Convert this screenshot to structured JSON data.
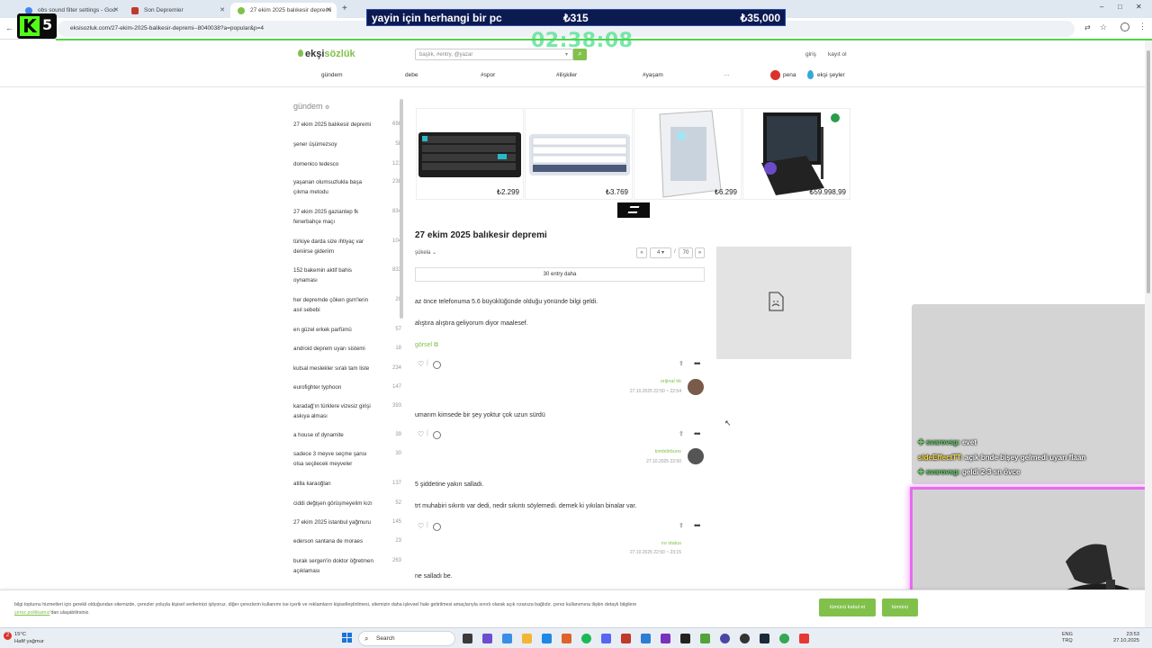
{
  "browser": {
    "tabs": [
      {
        "label": "obs sound filter settings - Goo",
        "active": false
      },
      {
        "label": "Son Depremler",
        "active": false
      },
      {
        "label": "27 ekim 2025 balıkesir depremi",
        "active": true
      }
    ],
    "new_tab": "+",
    "url": "eksisozluk.com/27-ekim-2025-balikesir-depremi--8040038?a=popular&p=4",
    "window_controls": [
      "–",
      "□",
      "✕"
    ]
  },
  "overlay": {
    "badge_number": "5",
    "goal_text": "yayin için herhangi bir pc",
    "goal_current": "₺315",
    "goal_target": "₺35,000",
    "timer": "02:38:08"
  },
  "site": {
    "logo_a": "ekşi",
    "logo_b": "sözlük",
    "search_placeholder": "başlık, #entry, @yazar",
    "login": "giriş",
    "register": "kayıt ol",
    "nav": [
      "gündem",
      "debe",
      "#spor",
      "#ilişkiler",
      "#yaşam",
      "···"
    ],
    "pena": "pena",
    "eksi_seyler": "ekşi şeyler"
  },
  "sidebar": {
    "title": "gündem",
    "items": [
      {
        "label": "27 ekim 2025 balıkesir depremi",
        "count": "698"
      },
      {
        "label": "şener üşümezsoy",
        "count": "58"
      },
      {
        "label": "domenico tedesco",
        "count": "121"
      },
      {
        "label": "yaşanan olumsuzlukla başa çıkma metodu",
        "count": "238"
      },
      {
        "label": "27 ekim 2025 gaziantep fk fenerbahçe maçı",
        "count": "834"
      },
      {
        "label": "türkiye darda size ihtiyaç var deniirse gideriim",
        "count": "104"
      },
      {
        "label": "152 bakemin aktif bahis oynaması",
        "count": "833"
      },
      {
        "label": "her depremde çöken gsm'lerin asıl sebebi",
        "count": "20"
      },
      {
        "label": "en güzel erkek parfümü",
        "count": "57"
      },
      {
        "label": "android deprem uyarı sistemi",
        "count": "18"
      },
      {
        "label": "kutsal meslekler sıralı tam liste",
        "count": "234"
      },
      {
        "label": "eurofighter typhoon",
        "count": "147"
      },
      {
        "label": "karadağ'ın türklere vizesiz girişi askıya alması",
        "count": "393"
      },
      {
        "label": "a house of dynamite",
        "count": "39"
      },
      {
        "label": "sadece 3 meyve seçme şansı olsa seçilecek meyveler",
        "count": "30"
      },
      {
        "label": "atilla karaoğlan",
        "count": "137"
      },
      {
        "label": "ciddi değişen görüşmeyelim kızı",
        "count": "52"
      },
      {
        "label": "27 ekim 2025 istanbul yağmuru",
        "count": "145"
      },
      {
        "label": "ederson santana de moraes",
        "count": "23"
      },
      {
        "label": "burak sergen'in doktor öğretmen açıklaması",
        "count": "263"
      }
    ]
  },
  "ads": [
    {
      "price": "₺2.299",
      "icon": "keyboard-black"
    },
    {
      "price": "₺3.769",
      "icon": "keyboard-white"
    },
    {
      "price": "₺6.299",
      "icon": "pc-case"
    },
    {
      "price": "₺59.998,99",
      "icon": "gpu-box"
    }
  ],
  "topic": {
    "title": "27 ekim 2025 balıkesir depremi",
    "sort": "şükela",
    "page_current": "4",
    "page_sep": "/",
    "page_total": "70",
    "prev": "«",
    "next": "»",
    "more_entries": "30 entry daha"
  },
  "entries": [
    {
      "lines": [
        "az önce telefonuma 5.6 büyüklüğünde olduğu yönünde bilgi geldi.",
        "alıştıra alıştıra geliyorum diyor maalesef."
      ],
      "link": "görsel",
      "author": "orijinal tık",
      "date": "27.10.2025 22:50 ~ 22:54"
    },
    {
      "lines": [
        "umarım kimsede bir şey yoktur çok uzun sürdü"
      ],
      "author": "kimbilirbuno",
      "date": "27.10.2025 22:50"
    },
    {
      "lines": [
        "5 şiddetine yakın salladı.",
        "trt muhabiri sıkıntı var dedi, nedir sıkıntı söylemedi. demek ki yıkılan binalar var."
      ],
      "author": "no status",
      "date": "27.10.2025 22:50 ~ 23:15"
    },
    {
      "lines": [
        "ne salladı be."
      ]
    }
  ],
  "cookie": {
    "text": "bilgi toplumu hizmetleri için gerekli olduğundan sitemizde, çerezler yoluyla kişisel verilerinizi işliyoruz. diğer çerezlerin kullanımı ise içerik ve reklamların kişiselleştirilmesi, sitemizin daha işlevsel hale getirilmesi amaçlarıyla sınırlı olarak açık rızanıza bağlıdır. çerez kullanımına ilişkin detaylı bilgilere",
    "link": "çerez politikamız",
    "text_end": "'dan ulaşabilirsiniz.",
    "accept": "tümünü kabul et",
    "reject": "tümünü"
  },
  "chat": [
    {
      "user": "svarovsg:",
      "msg": "evet"
    },
    {
      "user": "sideEffectTT:",
      "msg": "açık bnde bişey gelmedi uyarı flaan"
    },
    {
      "user": "svarovsg:",
      "msg": "geldi 2-3 sn övce"
    }
  ],
  "taskbar": {
    "temp": "15°C",
    "weather": "Hafif yağmur",
    "weather_badge": "2",
    "search": "Search",
    "lang1": "ENG",
    "lang2": "TRQ",
    "time": "23:53",
    "date": "27.10.2025"
  },
  "colors": {
    "accent": "#81c14b",
    "goal_bg": "#0c1a52",
    "webcam_border": "#e56bf0"
  }
}
